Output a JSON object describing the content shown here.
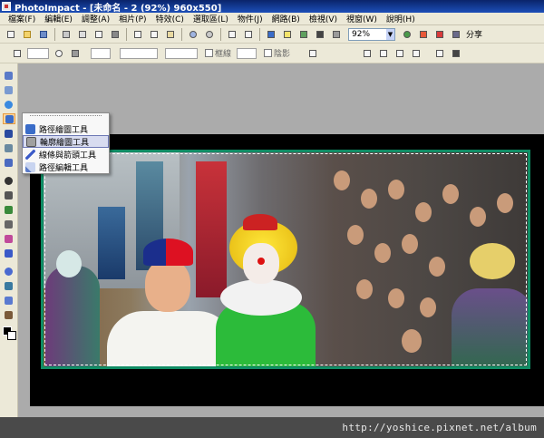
{
  "window": {
    "title": "PhotoImpact - [未命名 - 2 (92%) 960x550]"
  },
  "menu": {
    "items": [
      "檔案(F)",
      "編輯(E)",
      "調整(A)",
      "相片(P)",
      "特效(C)",
      "選取區(L)",
      "物件(J)",
      "網路(B)",
      "檢視(V)",
      "視窗(W)",
      "說明(H)"
    ]
  },
  "toolbar": {
    "zoom_value": "92%",
    "share_label": "分享"
  },
  "property_bar": {
    "border_label": "框線",
    "shadow_label": "陰影"
  },
  "flyout": {
    "items": [
      {
        "label": "路徑繪圖工具",
        "icon": "path-drawing-icon",
        "highlighted": false
      },
      {
        "label": "輪廓繪圖工具",
        "icon": "outline-drawing-icon",
        "highlighted": true
      },
      {
        "label": "線條與箭頭工具",
        "icon": "line-arrow-icon",
        "highlighted": false
      },
      {
        "label": "路徑編輯工具",
        "icon": "path-edit-icon",
        "highlighted": false
      }
    ]
  },
  "watermark": "http://yoshice.pixnet.net/album",
  "colors": {
    "canvas_border": "#0f8c64",
    "flyout_highlight": "#d8dcf0",
    "active_tool": "#fbd6a0"
  }
}
